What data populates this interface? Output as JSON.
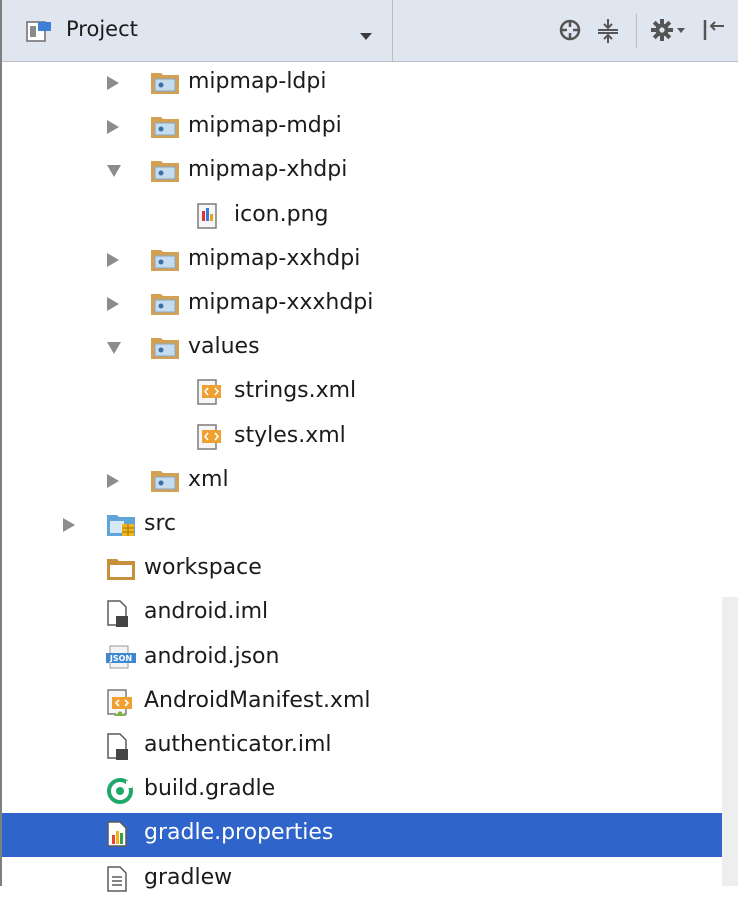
{
  "panel": {
    "title": "Project"
  },
  "tree": [
    {
      "label": "mipmap-ldpi",
      "icon": "folder-res-icon",
      "depth": 2,
      "arrow": "collapsed"
    },
    {
      "label": "mipmap-mdpi",
      "icon": "folder-res-icon",
      "depth": 2,
      "arrow": "collapsed"
    },
    {
      "label": "mipmap-xhdpi",
      "icon": "folder-res-icon",
      "depth": 2,
      "arrow": "expanded"
    },
    {
      "label": "icon.png",
      "icon": "image-file-icon",
      "depth": 3,
      "arrow": "none"
    },
    {
      "label": "mipmap-xxhdpi",
      "icon": "folder-res-icon",
      "depth": 2,
      "arrow": "collapsed"
    },
    {
      "label": "mipmap-xxxhdpi",
      "icon": "folder-res-icon",
      "depth": 2,
      "arrow": "collapsed"
    },
    {
      "label": "values",
      "icon": "folder-res-icon",
      "depth": 2,
      "arrow": "expanded"
    },
    {
      "label": "strings.xml",
      "icon": "xml-file-icon",
      "depth": 3,
      "arrow": "none"
    },
    {
      "label": "styles.xml",
      "icon": "xml-file-icon",
      "depth": 3,
      "arrow": "none"
    },
    {
      "label": "xml",
      "icon": "folder-res-icon",
      "depth": 2,
      "arrow": "collapsed"
    },
    {
      "label": "src",
      "icon": "folder-src-icon",
      "depth": 1,
      "arrow": "collapsed"
    },
    {
      "label": "workspace",
      "icon": "folder-icon",
      "depth": 1,
      "arrow": "none"
    },
    {
      "label": "android.iml",
      "icon": "iml-file-icon",
      "depth": 1,
      "arrow": "none"
    },
    {
      "label": "android.json",
      "icon": "json-file-icon",
      "depth": 1,
      "arrow": "none"
    },
    {
      "label": "AndroidManifest.xml",
      "icon": "manifest-file-icon",
      "depth": 1,
      "arrow": "none"
    },
    {
      "label": "authenticator.iml",
      "icon": "iml-file-icon",
      "depth": 1,
      "arrow": "none"
    },
    {
      "label": "build.gradle",
      "icon": "gradle-file-icon",
      "depth": 1,
      "arrow": "none"
    },
    {
      "label": "gradle.properties",
      "icon": "properties-file-icon",
      "depth": 1,
      "arrow": "none",
      "selected": true
    },
    {
      "label": "gradlew",
      "icon": "text-file-icon",
      "depth": 1,
      "arrow": "none"
    }
  ],
  "colors": {
    "selection": "#2f65ca",
    "toolbar": "#dfe6ef",
    "folder": "#c7913b"
  }
}
